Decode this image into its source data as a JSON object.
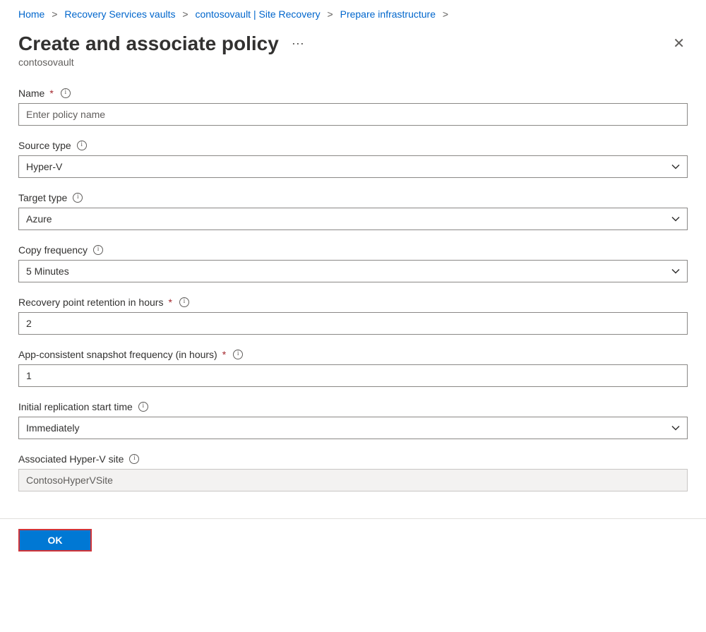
{
  "breadcrumb": {
    "home": "Home",
    "vaults": "Recovery Services vaults",
    "vault": "contosovault | Site Recovery",
    "prepare": "Prepare infrastructure"
  },
  "header": {
    "title": "Create and associate policy",
    "subtitle": "contosovault"
  },
  "form": {
    "name_label": "Name",
    "name_placeholder": "Enter policy name",
    "name_value": "",
    "source_type_label": "Source type",
    "source_type_value": "Hyper-V",
    "target_type_label": "Target type",
    "target_type_value": "Azure",
    "copy_freq_label": "Copy frequency",
    "copy_freq_value": "5 Minutes",
    "retention_label": "Recovery point retention in hours",
    "retention_value": "2",
    "snapshot_label": "App-consistent snapshot frequency (in hours)",
    "snapshot_value": "1",
    "initial_label": "Initial replication start time",
    "initial_value": "Immediately",
    "assoc_label": "Associated Hyper-V site",
    "assoc_value": "ContosoHyperVSite"
  },
  "footer": {
    "ok_label": "OK"
  }
}
